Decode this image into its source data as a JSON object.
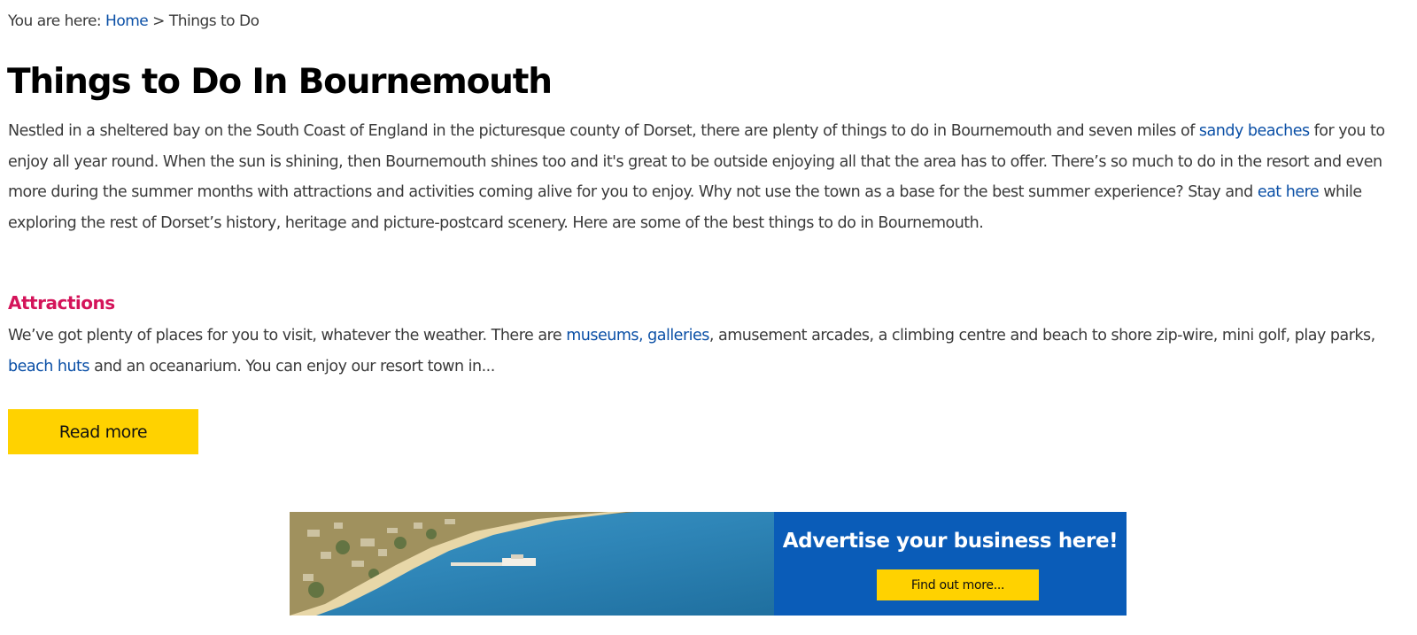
{
  "breadcrumb": {
    "prefix": "You are here:",
    "home_link": "Home",
    "separator": ">",
    "current": "Things to Do"
  },
  "page_title": "Things to Do In Bournemouth",
  "intro": {
    "part1": "Nestled in a sheltered bay on the South Coast of England in the picturesque county of Dorset, there are plenty of things to do in Bournemouth and seven miles of ",
    "link1": "sandy beaches",
    "part2": " for you to enjoy all year round. When the sun is shining, then Bournemouth shines too and it's great to be outside enjoying all that the area has to offer. There’s so much to do in the resort and even more during the summer months with attractions and activities coming alive for you to enjoy. Why not use the town as a base for the best summer experience? Stay and ",
    "link2": "eat here",
    "part3": " while exploring the rest of Dorset’s history, heritage and picture-postcard scenery. Here are some of the best things to do in Bournemouth."
  },
  "attractions": {
    "heading": "Attractions",
    "part1": "We’ve got plenty of places for you to visit, whatever the weather. There are ",
    "link_museums": "museums",
    "comma": ", ",
    "link_galleries": "galleries",
    "part2": ", amusement arcades, a climbing centre and beach to shore zip-wire, mini golf, play parks, ",
    "link_beach_huts": "beach huts",
    "part3": " and an oceanarium. You can enjoy our resort town in...",
    "read_more_label": "Read more"
  },
  "banner": {
    "title": "Advertise your business here!",
    "button_label": "Find out more...",
    "image": "bournemouth-coast-pier-photo"
  },
  "colors": {
    "link": "#0a4fa6",
    "heading_accent": "#d4145a",
    "button_yellow": "#ffd200",
    "banner_blue": "#0a5cb8"
  }
}
